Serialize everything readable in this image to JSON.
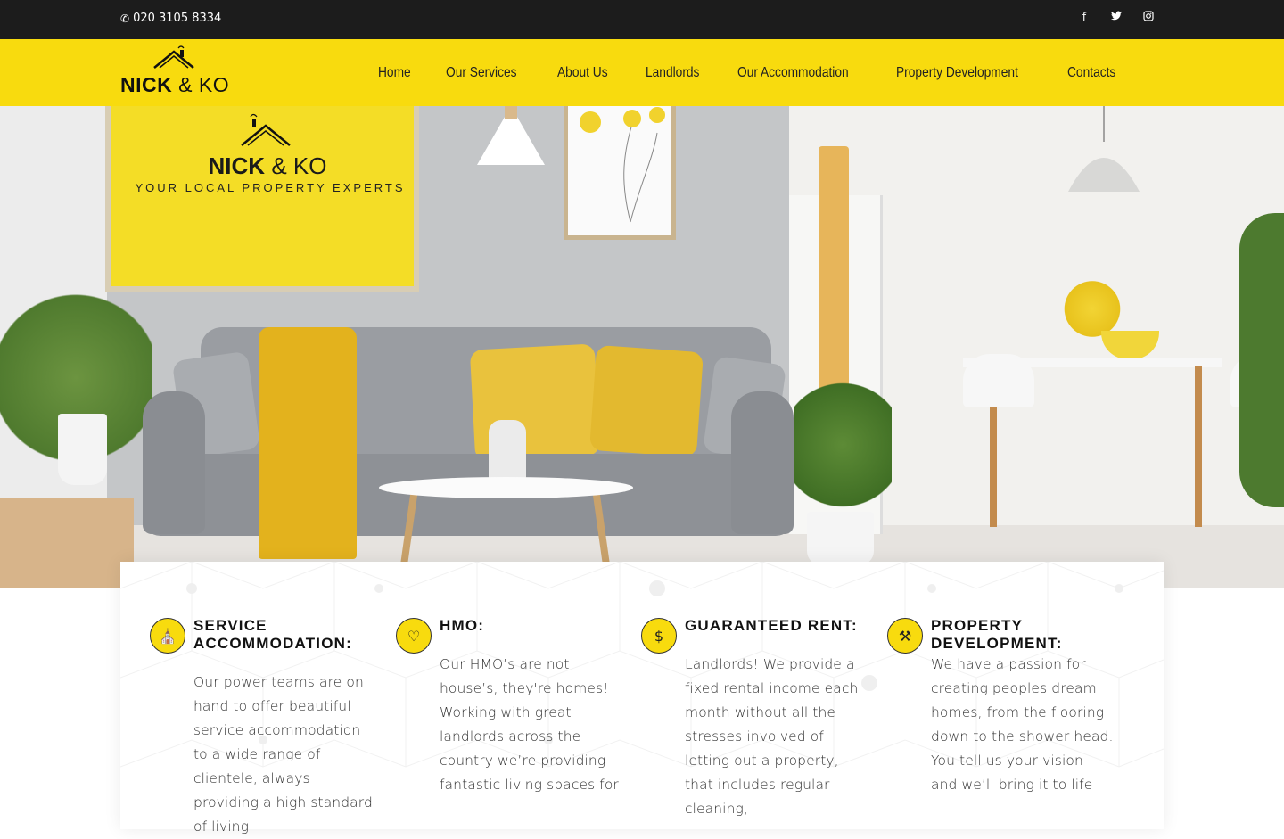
{
  "topbar": {
    "phone": "020 3105 8334",
    "socials": [
      "facebook-icon",
      "twitter-icon",
      "instagram-icon"
    ]
  },
  "header": {
    "logo_text_1": "NICK",
    "logo_amp": "&",
    "logo_text_2": "KO",
    "nav": [
      "Home",
      "Our Services",
      "About Us",
      "Landlords",
      "Our Accommodation",
      "Property Development",
      "Contacts"
    ],
    "accent_color": "#f8db0e"
  },
  "hero": {
    "poster_title_1": "NICK",
    "poster_amp": "&",
    "poster_title_2": "KO",
    "poster_tagline": "YOUR LOCAL PROPERTY EXPERTS"
  },
  "features": [
    {
      "icon": "service-accommodation-icon",
      "title": "SERVICE ACCOMMODATION:",
      "text": "Our power teams are on hand to offer beautiful service accommodation to a wide range of clientele, always providing a high standard of living"
    },
    {
      "icon": "hmo-icon",
      "title": "HMO:",
      "text": "Our HMO’s are not house’s, they're homes! Working with great landlords across the country we’re providing fantastic living spaces for"
    },
    {
      "icon": "guaranteed-rent-icon",
      "title": "GUARANTEED RENT:",
      "text": "Landlords! We provide a fixed rental income each month without all the stresses involved of letting out a property, that includes regular cleaning,"
    },
    {
      "icon": "property-development-icon",
      "title": "PROPERTY DEVELOPMENT:",
      "text": "We have a passion for creating peoples dream homes, from the flooring down to the shower head. You tell us your vision and we’ll bring it to life"
    }
  ]
}
